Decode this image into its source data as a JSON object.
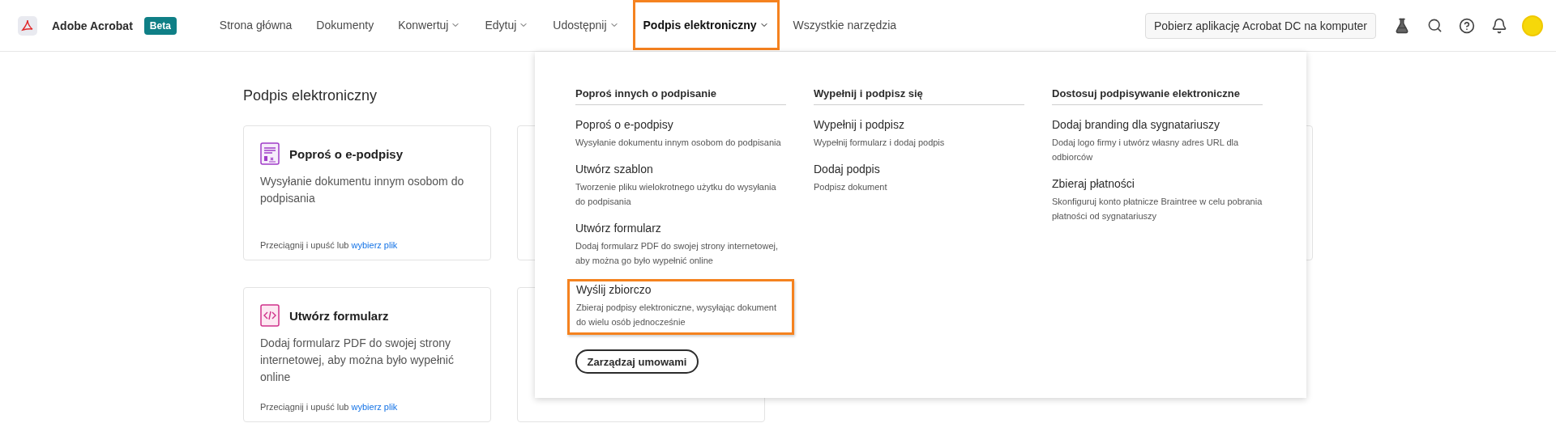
{
  "app": {
    "name": "Adobe Acrobat",
    "badge": "Beta"
  },
  "nav": [
    {
      "label": "Strona główna",
      "dropdown": false,
      "selected": false
    },
    {
      "label": "Dokumenty",
      "dropdown": false,
      "selected": false
    },
    {
      "label": "Konwertuj",
      "dropdown": true,
      "selected": false
    },
    {
      "label": "Edytuj",
      "dropdown": true,
      "selected": false
    },
    {
      "label": "Udostępnij",
      "dropdown": true,
      "selected": false
    },
    {
      "label": "Podpis elektroniczny",
      "dropdown": true,
      "selected": true
    },
    {
      "label": "Wszystkie narzędzia",
      "dropdown": false,
      "selected": false
    }
  ],
  "download_button": "Pobierz aplikację Acrobat DC na komputer",
  "page_title": "Podpis elektroniczny",
  "cards": [
    {
      "kind": "full",
      "title": "Poproś o e-podpisy",
      "description": "Wysyłanie dokumentu innym osobom do podpisania",
      "drop_text": "Przeciągnij i upuść lub",
      "link": "wybierz plik"
    },
    {
      "kind": "full",
      "title": "Utwórz formularz",
      "description": "Dodaj formularz PDF do swojej strony internetowej, aby można było wypełnić online",
      "drop_text": "Przeciągnij i upuść lub",
      "link": "wybierz plik"
    }
  ],
  "menu": {
    "columns": [
      {
        "heading": "Poproś innych o podpisanie",
        "items": [
          {
            "title": "Poproś o e-podpisy",
            "description": "Wysyłanie dokumentu innym osobom do podpisania",
            "highlighted": false
          },
          {
            "title": "Utwórz szablon",
            "description": "Tworzenie pliku wielokrotnego użytku do wysyłania do podpisania",
            "highlighted": false
          },
          {
            "title": "Utwórz formularz",
            "description": "Dodaj formularz PDF do swojej strony internetowej, aby można go było wypełnić online",
            "highlighted": false
          },
          {
            "title": "Wyślij zbiorczo",
            "description": "Zbieraj podpisy elektroniczne, wysyłając dokument do wielu osób jednocześnie",
            "highlighted": true
          }
        ]
      },
      {
        "heading": "Wypełnij i podpisz się",
        "items": [
          {
            "title": "Wypełnij i podpisz",
            "description": "Wypełnij formularz i dodaj podpis",
            "highlighted": false
          },
          {
            "title": "Dodaj podpis",
            "description": "Podpisz dokument",
            "highlighted": false
          }
        ]
      },
      {
        "heading": "Dostosuj podpisywanie elektroniczne",
        "items": [
          {
            "title": "Dodaj branding dla sygnatariuszy",
            "description": "Dodaj logo firmy i utwórz własny adres URL dla odbiorców",
            "highlighted": false
          },
          {
            "title": "Zbieraj płatności",
            "description": "Skonfiguruj konto płatnicze Braintree w celu pobrania płatności od sygnatariuszy",
            "highlighted": false
          }
        ]
      }
    ],
    "manage_button": "Zarządzaj umowami"
  }
}
